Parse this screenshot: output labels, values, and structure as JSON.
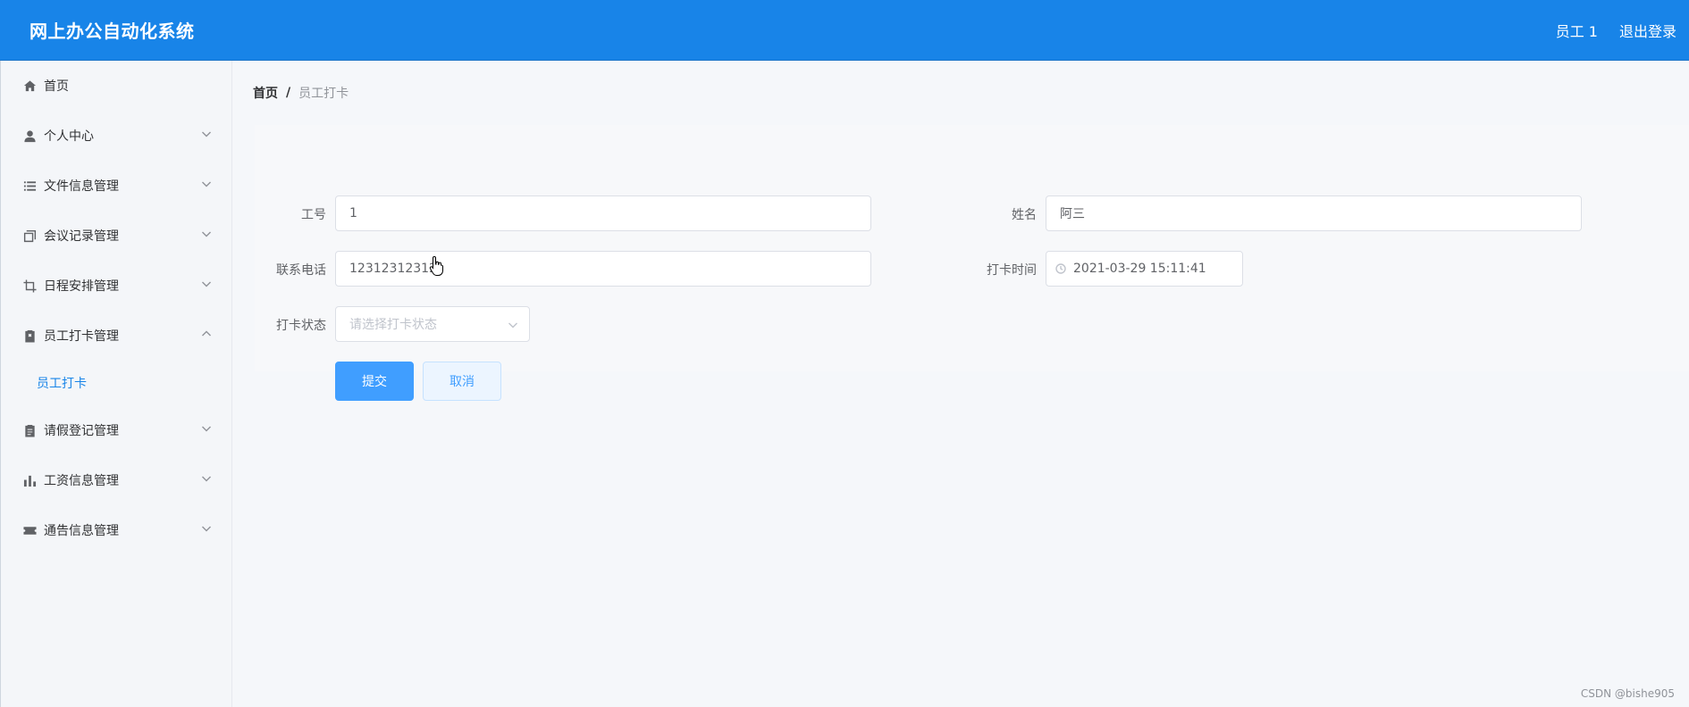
{
  "header": {
    "title": "网上办公自动化系统",
    "user": "员工 1",
    "logout": "退出登录"
  },
  "sidebar": {
    "items": [
      {
        "label": "首页",
        "icon": "home-icon"
      },
      {
        "label": "个人中心",
        "icon": "user-icon"
      },
      {
        "label": "文件信息管理",
        "icon": "list-icon"
      },
      {
        "label": "会议记录管理",
        "icon": "copy-icon"
      },
      {
        "label": "日程安排管理",
        "icon": "crop-icon"
      },
      {
        "label": "员工打卡管理",
        "icon": "clipboard-x-icon",
        "expanded": true
      },
      {
        "label": "请假登记管理",
        "icon": "clipboard-icon"
      },
      {
        "label": "工资信息管理",
        "icon": "bar-chart-icon"
      },
      {
        "label": "通告信息管理",
        "icon": "ticket-icon"
      }
    ],
    "subitem": "员工打卡"
  },
  "breadcrumb": {
    "home": "首页",
    "separator": "/",
    "current": "员工打卡"
  },
  "form": {
    "emp_no_label": "工号",
    "emp_no_value": "1",
    "name_label": "姓名",
    "name_value": "阿三",
    "phone_label": "联系电话",
    "phone_value": "12312312312",
    "time_label": "打卡时间",
    "time_value": "2021-03-29 15:11:41",
    "status_label": "打卡状态",
    "status_placeholder": "请选择打卡状态",
    "submit": "提交",
    "cancel": "取消"
  },
  "watermark": "CSDN @bishe905",
  "colors": {
    "header_bg": "#1884e8",
    "primary": "#409eff",
    "active_submenu": "#1884e8"
  }
}
